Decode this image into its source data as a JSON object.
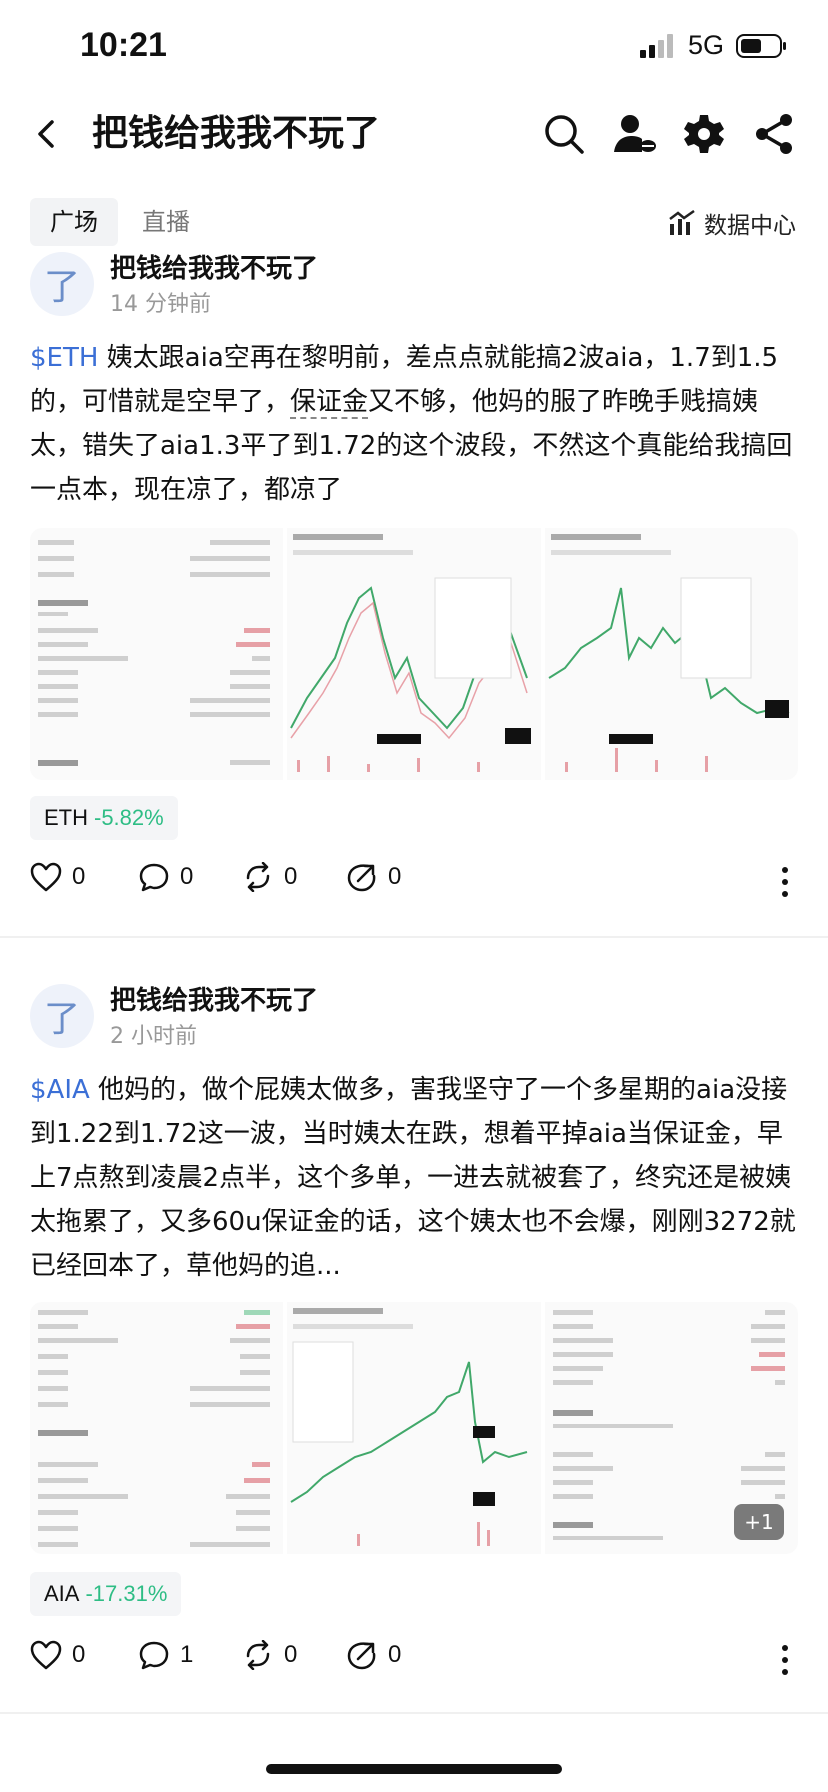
{
  "status": {
    "time": "10:21",
    "network": "5G"
  },
  "header": {
    "title": "把钱给我我不玩了"
  },
  "tabs": [
    {
      "label": "广场"
    },
    {
      "label": "直播"
    }
  ],
  "data_center": {
    "label": "数据中心"
  },
  "posts": [
    {
      "author": "把钱给我我不玩了",
      "avatar_letter": "了",
      "time": "14 分钟前",
      "tag": "$ETH",
      "text_a": " 姨太跟aia空再在黎明前，差点点就能搞2波aia，1.7到1.5的，可惜就是空早了，",
      "text_u": "保证金",
      "text_b": "又不够，他妈的服了昨晚手贱搞姨太，错失了aia1.3平了到1.72的这个波段，不然这个真能给我搞回一点本，现在凉了，都凉了",
      "chip": {
        "symbol": "ETH",
        "change": "-5.82%"
      },
      "likes": "0",
      "comments": "0",
      "reposts": "0",
      "shares": "0"
    },
    {
      "author": "把钱给我我不玩了",
      "avatar_letter": "了",
      "time": "2 小时前",
      "tag": "$AIA",
      "text_a": " 他妈的，做个屁姨太做多，害我坚守了一个多星期的aia没接到1.22到1.72这一波，当时姨太在跌，想着平掉aia当保证金，早上7点熬到凌晨2点半，这个多单，一进去就被套了，终究还是被姨太拖累了，又多60u保证金的话，这个姨太也不会爆，刚刚3272就已经回本了，草他妈的追...",
      "more_images": "+1",
      "chip": {
        "symbol": "AIA",
        "change": "-17.31%"
      },
      "likes": "0",
      "comments": "1",
      "reposts": "0",
      "shares": "0"
    }
  ],
  "colors": {
    "accent": "#3b6fd6",
    "down": "#2ebd85",
    "up": "#e35561"
  }
}
